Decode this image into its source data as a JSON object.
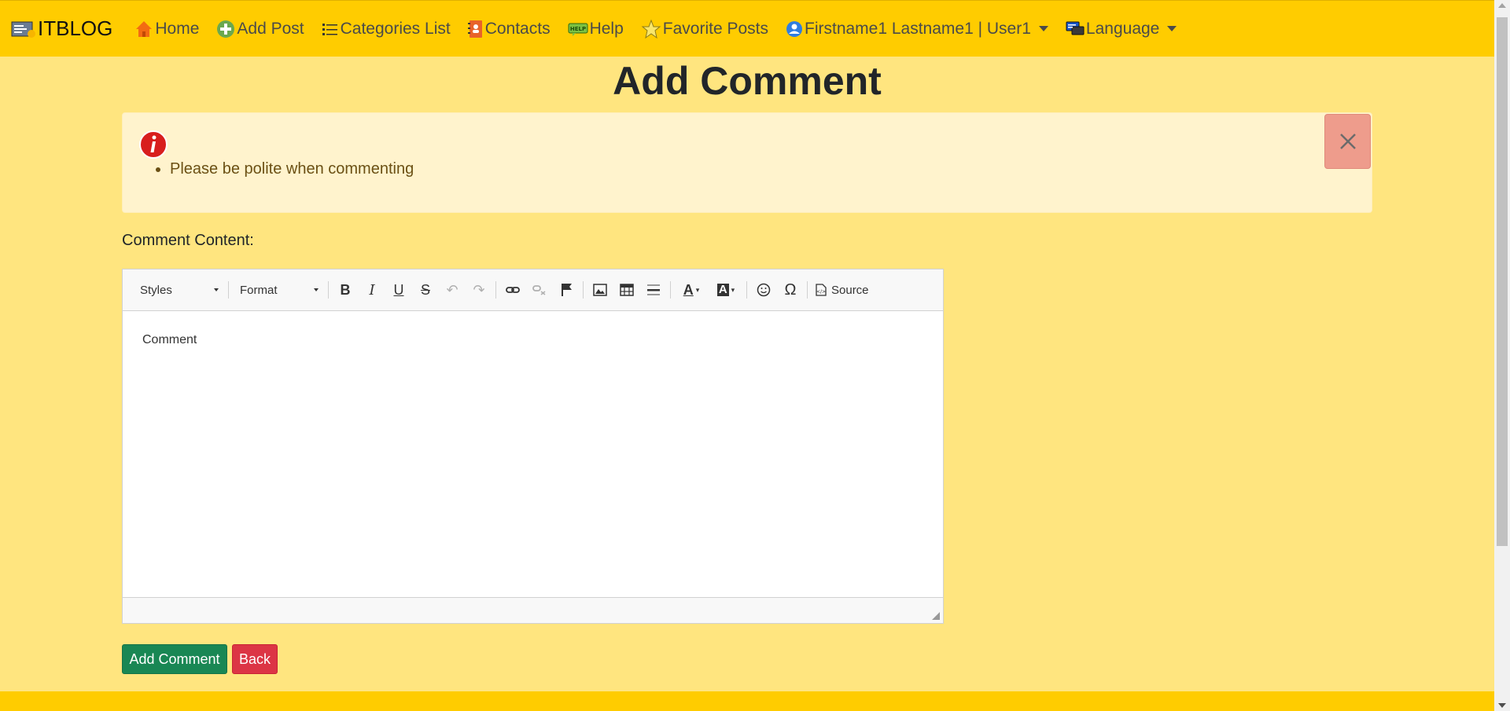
{
  "nav": {
    "brand": "ITBLOG",
    "items": [
      {
        "label": "Home",
        "icon": "home-icon"
      },
      {
        "label": "Add Post",
        "icon": "add-icon"
      },
      {
        "label": "Categories List",
        "icon": "list-icon"
      },
      {
        "label": "Contacts",
        "icon": "contacts-icon"
      },
      {
        "label": "Help",
        "icon": "help-icon"
      },
      {
        "label": "Favorite Posts",
        "icon": "star-icon"
      }
    ],
    "user": "Firstname1 Lastname1 | User1",
    "language": "Language"
  },
  "page": {
    "title": "Add Comment"
  },
  "alert": {
    "items": [
      "Please be polite when commenting"
    ]
  },
  "form": {
    "label": "Comment Content:",
    "editor": {
      "styles_label": "Styles",
      "format_label": "Format",
      "source_label": "Source",
      "content": "Comment"
    },
    "submit_label": "Add Comment",
    "back_label": "Back"
  },
  "colors": {
    "navbar": "#ffcc00",
    "page_bg": "#ffe57f",
    "alert_bg": "#fff3cd",
    "close_bg": "#ee9c8c",
    "success": "#198754",
    "danger": "#dc3545"
  }
}
